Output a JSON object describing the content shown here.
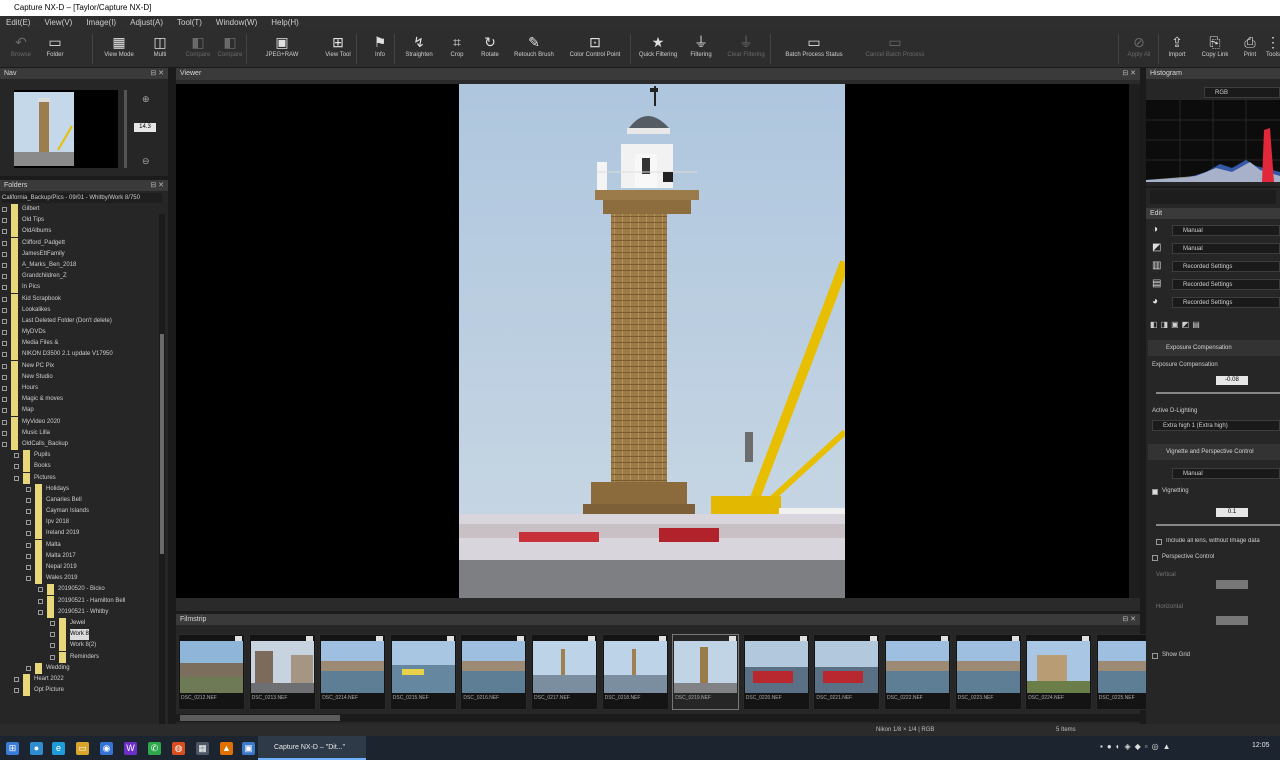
{
  "titlebar": {
    "text": "Capture NX-D – [Taylor/Capture NX-D]"
  },
  "menu": {
    "items": [
      "Edit(E)",
      "View(V)",
      "Image(I)",
      "Adjust(A)",
      "Tool(T)",
      "Window(W)",
      "Help(H)"
    ]
  },
  "toolbar": {
    "buttons": [
      {
        "label": "Browse",
        "icon": "back-arrow-icon",
        "enabled": false
      },
      {
        "label": "Folder",
        "icon": "folder-icon",
        "enabled": true
      },
      {
        "label": "View Mode",
        "icon": "view-mode-icon",
        "enabled": true
      },
      {
        "label": "Multi",
        "icon": "multi-view-icon",
        "enabled": true
      },
      {
        "label": "Compare",
        "icon": "compare-icon",
        "enabled": false
      },
      {
        "label": "Compare",
        "icon": "compare-icon",
        "enabled": false
      },
      {
        "label": "JPEG+RAW",
        "icon": "stack-icon",
        "enabled": true
      },
      {
        "label": "View Tool",
        "icon": "view-tool-icon",
        "enabled": true
      },
      {
        "label": "Info",
        "icon": "info-flag-icon",
        "enabled": true
      },
      {
        "label": "Straighten",
        "icon": "straighten-icon",
        "enabled": true
      },
      {
        "label": "Crop",
        "icon": "crop-icon",
        "enabled": true
      },
      {
        "label": "Rotate",
        "icon": "rotate-icon",
        "enabled": true
      },
      {
        "label": "Retouch Brush",
        "icon": "brush-icon",
        "enabled": true
      },
      {
        "label": "Color Control Point",
        "icon": "control-point-icon",
        "enabled": true
      },
      {
        "label": "Quick Filtering",
        "icon": "star-icon",
        "enabled": true
      },
      {
        "label": "Filtering",
        "icon": "filter-icon",
        "enabled": true
      },
      {
        "label": "Clear Filtering",
        "icon": "clear-filter-icon",
        "enabled": false
      },
      {
        "label": "Batch Process Status",
        "icon": "batch-status-icon",
        "enabled": true
      },
      {
        "label": "Cancel Batch Process",
        "icon": "cancel-batch-icon",
        "enabled": false
      },
      {
        "label": "Apply All",
        "icon": "apply-all-icon",
        "enabled": false
      },
      {
        "label": "Import",
        "icon": "import-icon",
        "enabled": true
      },
      {
        "label": "Copy Link",
        "icon": "copy-link-icon",
        "enabled": true
      },
      {
        "label": "Print",
        "icon": "print-icon",
        "enabled": true
      },
      {
        "label": "Tools",
        "icon": "tools-icon",
        "enabled": true
      }
    ]
  },
  "navigator": {
    "title": "Nav",
    "zoom": "14.3"
  },
  "folders": {
    "title": "Folders",
    "path": "California_Backup/Pics - 09/01 - Whitby/Work 8/750",
    "items": [
      {
        "label": "Gilbert",
        "depth": 0
      },
      {
        "label": "Old Tips",
        "depth": 0
      },
      {
        "label": "OldAlbums",
        "depth": 0
      },
      {
        "label": "Clifford_Padgett",
        "depth": 0
      },
      {
        "label": "JamesEttFamily",
        "depth": 0
      },
      {
        "label": "A_Marks_Ben_2018",
        "depth": 0
      },
      {
        "label": "Grandchildren_Z",
        "depth": 0
      },
      {
        "label": "In Pics",
        "depth": 0
      },
      {
        "label": "Kid Scrapbook",
        "depth": 0
      },
      {
        "label": "Lookalikes",
        "depth": 0
      },
      {
        "label": "Last Deleted Folder (Don't delete)",
        "depth": 0
      },
      {
        "label": "MyDVDs",
        "depth": 0
      },
      {
        "label": "Media Files &",
        "depth": 0
      },
      {
        "label": "NIKON D3500 2.1 update V17950",
        "depth": 0
      },
      {
        "label": "New PC Pix",
        "depth": 0
      },
      {
        "label": "New Studio",
        "depth": 0
      },
      {
        "label": "Hours",
        "depth": 0
      },
      {
        "label": "Magic & moves",
        "depth": 0
      },
      {
        "label": "Map",
        "depth": 0
      },
      {
        "label": "MyVideo 2020",
        "depth": 0
      },
      {
        "label": "Music Lilla",
        "depth": 0
      },
      {
        "label": "OldCalls_Backup",
        "depth": 0
      },
      {
        "label": "Pupils",
        "depth": 1
      },
      {
        "label": "Books",
        "depth": 1
      },
      {
        "label": "Pictures",
        "depth": 1
      },
      {
        "label": "Holidays",
        "depth": 2
      },
      {
        "label": "Canaries Bell",
        "depth": 2
      },
      {
        "label": "Cayman Islands",
        "depth": 2
      },
      {
        "label": "Ipv 2018",
        "depth": 2
      },
      {
        "label": "Ireland 2019",
        "depth": 2
      },
      {
        "label": "Malta",
        "depth": 2
      },
      {
        "label": "Malta 2017",
        "depth": 2
      },
      {
        "label": "Nepal 2019",
        "depth": 2
      },
      {
        "label": "Wales 2019",
        "depth": 2
      },
      {
        "label": "20190520 - Bicko",
        "depth": 3
      },
      {
        "label": "20190521 - Hamilton Bell",
        "depth": 3
      },
      {
        "label": "20190521 - Whitby",
        "depth": 3
      },
      {
        "label": "Jewel",
        "depth": 4
      },
      {
        "label": "Work 8",
        "depth": 4
      },
      {
        "label": "Work 8(2)",
        "depth": 4
      },
      {
        "label": "Reminders",
        "depth": 4
      },
      {
        "label": "Wedding",
        "depth": 2
      },
      {
        "label": "Heart 2022",
        "depth": 1
      },
      {
        "label": "Opt Picture",
        "depth": 1
      }
    ]
  },
  "viewer": {
    "title": "Viewer"
  },
  "filmstrip": {
    "title": "Filmstrip",
    "items": [
      {
        "caption": "DSC_0212.NEF",
        "scene": "harbour-houses"
      },
      {
        "caption": "DSC_0213.NEF",
        "scene": "street"
      },
      {
        "caption": "DSC_0214.NEF",
        "scene": "harbour-water"
      },
      {
        "caption": "DSC_0215.NEF",
        "scene": "boat"
      },
      {
        "caption": "DSC_0216.NEF",
        "scene": "harbour-water"
      },
      {
        "caption": "DSC_0217.NEF",
        "scene": "lighthouse-far"
      },
      {
        "caption": "DSC_0218.NEF",
        "scene": "lighthouse-far"
      },
      {
        "caption": "DSC_0219.NEF",
        "scene": "lighthouse"
      },
      {
        "caption": "DSC_0220.NEF",
        "scene": "red-boat"
      },
      {
        "caption": "DSC_0221.NEF",
        "scene": "red-boat"
      },
      {
        "caption": "DSC_0222.NEF",
        "scene": "harbour-water"
      },
      {
        "caption": "DSC_0223.NEF",
        "scene": "harbour-water"
      },
      {
        "caption": "DSC_0224.NEF",
        "scene": "abbey"
      },
      {
        "caption": "DSC_0225.NEF",
        "scene": "harbour-water"
      }
    ],
    "selected_index": 7
  },
  "histogram": {
    "title": "Histogram",
    "channel": "RGB"
  },
  "adjustments": {
    "title": "Edit",
    "rows": [
      {
        "icon": "white-balance-icon",
        "value": "Manual"
      },
      {
        "icon": "picture-control-icon",
        "value": "Manual"
      },
      {
        "icon": "lens-icon",
        "value": "Recorded Settings"
      },
      {
        "icon": "tone-icon",
        "value": "Recorded Settings"
      },
      {
        "icon": "noise-icon",
        "value": "Recorded Settings"
      }
    ],
    "exposure": {
      "section": "Exposure Compensation",
      "label": "Exposure Compensation",
      "value": "-0.08"
    },
    "dlighting": {
      "label": "Active D-Lighting",
      "value": "Extra high 1 (Extra high)"
    },
    "lens": {
      "section": "Vignette and Perspective Control",
      "value": "Manual"
    },
    "vignette": {
      "label": "Vignetting",
      "value": "0.1"
    },
    "vignette_check": "Include all lens, without Image data",
    "perspective": {
      "label": "Perspective Control",
      "horizontal": "Vertical",
      "vertical": "Horizontal"
    },
    "retouch": "Show Grid"
  },
  "status": {
    "left": "",
    "center": "Nikon 1/8 × 1/4 | RGB",
    "right": "5 Items"
  },
  "taskbar": {
    "app_label": "Capture NX-D – \"Dit...\"",
    "time": "12:05"
  },
  "colors": {
    "folder": "#e8d77a",
    "sky": "#bcd2e6",
    "tower": "#a08050",
    "crane": "#f2c000"
  }
}
